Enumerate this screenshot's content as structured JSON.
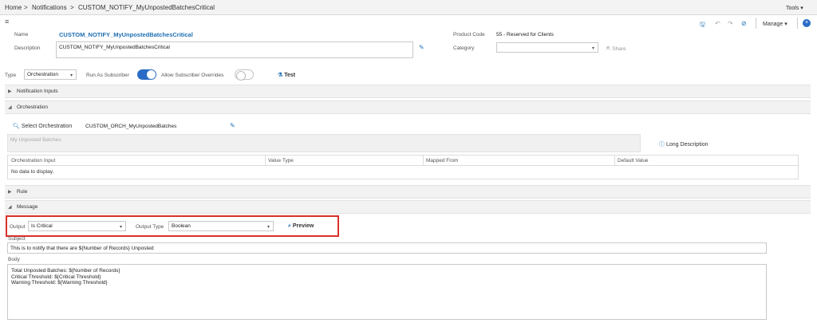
{
  "breadcrumb": {
    "home": "Home",
    "sep1": ">",
    "notifications": "Notifications",
    "sep2": ">",
    "current": "CUSTOM_NOTIFY_MyUnpostedBatchesCritical"
  },
  "toolbar": {
    "tools": "Tools",
    "manage": "Manage"
  },
  "header": {
    "name_label": "Name",
    "name_value": "CUSTOM_NOTIFY_MyUnpostedBatchesCritical",
    "description_label": "Description",
    "description_value": "CUSTOM_NOTIFY_MyUnpostedBatchesCritical",
    "product_code_label": "Product Code",
    "product_code_value": "55 - Reserved for Clients",
    "category_label": "Category",
    "category_value": "",
    "share_label": "Share"
  },
  "type_row": {
    "type_label": "Type",
    "type_value": "Orchestration",
    "run_as_subscriber_label": "Run As Subscriber",
    "run_as_subscriber_on": true,
    "allow_overrides_label": "Allow Subscriber Overrides",
    "allow_overrides_on": false,
    "test_label": "Test"
  },
  "sections": {
    "notification_inputs": "Notification Inputs",
    "orchestration": "Orchestration",
    "rule": "Rule",
    "message": "Message"
  },
  "orchestration": {
    "select_label": "Select Orchestration",
    "selected_value": "CUSTOM_ORCH_MyUnpostedBatches",
    "description_placeholder": "My Unposted Batches",
    "long_description_label": "Long Description",
    "columns": [
      "Orchestration Input",
      "Value Type",
      "Mapped From",
      "Default Value"
    ],
    "empty_text": "No data to display."
  },
  "message": {
    "output_label": "Output",
    "output_value": "Is Critical",
    "output_type_label": "Output Type",
    "output_type_value": "Boolean",
    "preview_label": "Preview",
    "subject_label": "Subject",
    "subject_value": "This is to notify that there are ${Number of Records} Unposted",
    "body_label": "Body",
    "body_lines": [
      "Total Unposted Batches: ${Number of Records}",
      "Critical Threshold: ${Critical Threshold}",
      "Warning Threshold: ${Warning Threshold}"
    ]
  },
  "colors": {
    "link": "#1f6fb2",
    "highlight_border": "#d9302b",
    "toggle_on": "#2a6cc5"
  }
}
